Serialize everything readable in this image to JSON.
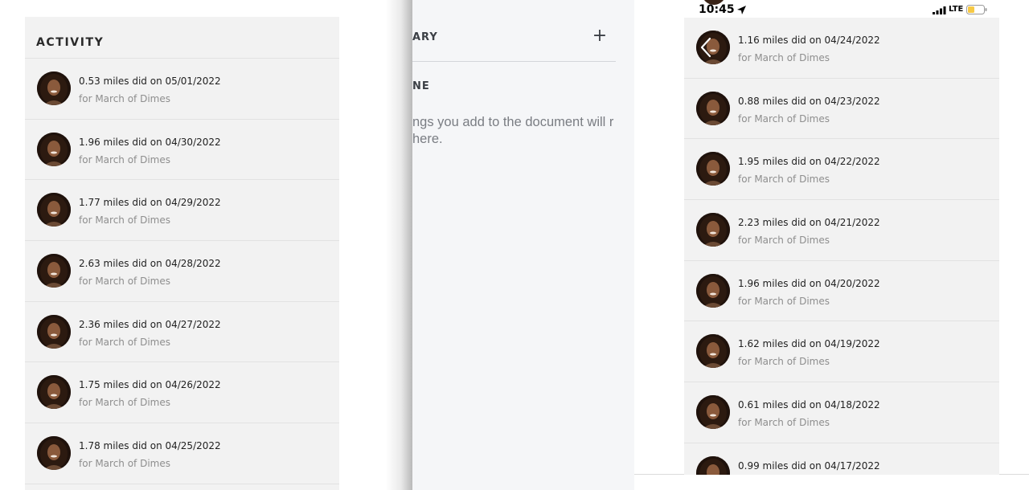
{
  "left_panel": {
    "title": "ACTIVITY",
    "items": [
      {
        "title": "0.53 miles did on 05/01/2022",
        "subtitle": "for March of Dimes"
      },
      {
        "title": "1.96 miles did on 04/30/2022",
        "subtitle": "for March of Dimes"
      },
      {
        "title": "1.77 miles did on 04/29/2022",
        "subtitle": "for March of Dimes"
      },
      {
        "title": "2.63 miles did on 04/28/2022",
        "subtitle": "for March of Dimes"
      },
      {
        "title": "2.36 miles did on 04/27/2022",
        "subtitle": "for March of Dimes"
      },
      {
        "title": "1.75 miles did on 04/26/2022",
        "subtitle": "for March of Dimes"
      },
      {
        "title": "1.78 miles did on 04/25/2022",
        "subtitle": "for March of Dimes"
      }
    ]
  },
  "middle_panel": {
    "section_label": "ARY",
    "add_label": "+",
    "section_label_2": "NE",
    "empty_text": "ngs you add to the document will r here."
  },
  "status_bar": {
    "time": "10:45",
    "network": "LTE",
    "icons": [
      "location-arrow-icon",
      "signal-bars-icon",
      "battery-low-icon"
    ]
  },
  "right_list": {
    "back_icon": "chevron-left-icon",
    "items": [
      {
        "title": "1.16 miles did on 04/24/2022",
        "subtitle": "for March of Dimes"
      },
      {
        "title": "0.88 miles did on 04/23/2022",
        "subtitle": "for March of Dimes"
      },
      {
        "title": "1.95 miles did on 04/22/2022",
        "subtitle": "for March of Dimes"
      },
      {
        "title": "2.23 miles did on 04/21/2022",
        "subtitle": "for March of Dimes"
      },
      {
        "title": "1.96 miles did on 04/20/2022",
        "subtitle": "for March of Dimes"
      },
      {
        "title": "1.62 miles did on 04/19/2022",
        "subtitle": "for March of Dimes"
      },
      {
        "title": "0.61 miles did on 04/18/2022",
        "subtitle": "for March of Dimes"
      },
      {
        "title": "0.99 miles did on 04/17/2022",
        "subtitle": ""
      }
    ]
  },
  "colors": {
    "list_background": "#f2f2f2",
    "row_divider": "#e2e2e2",
    "title_text": "#1f1f1f",
    "subtitle_text": "#8e8e8e",
    "document_background": "#f5f6f8",
    "battery_fill": "#f6c945"
  }
}
